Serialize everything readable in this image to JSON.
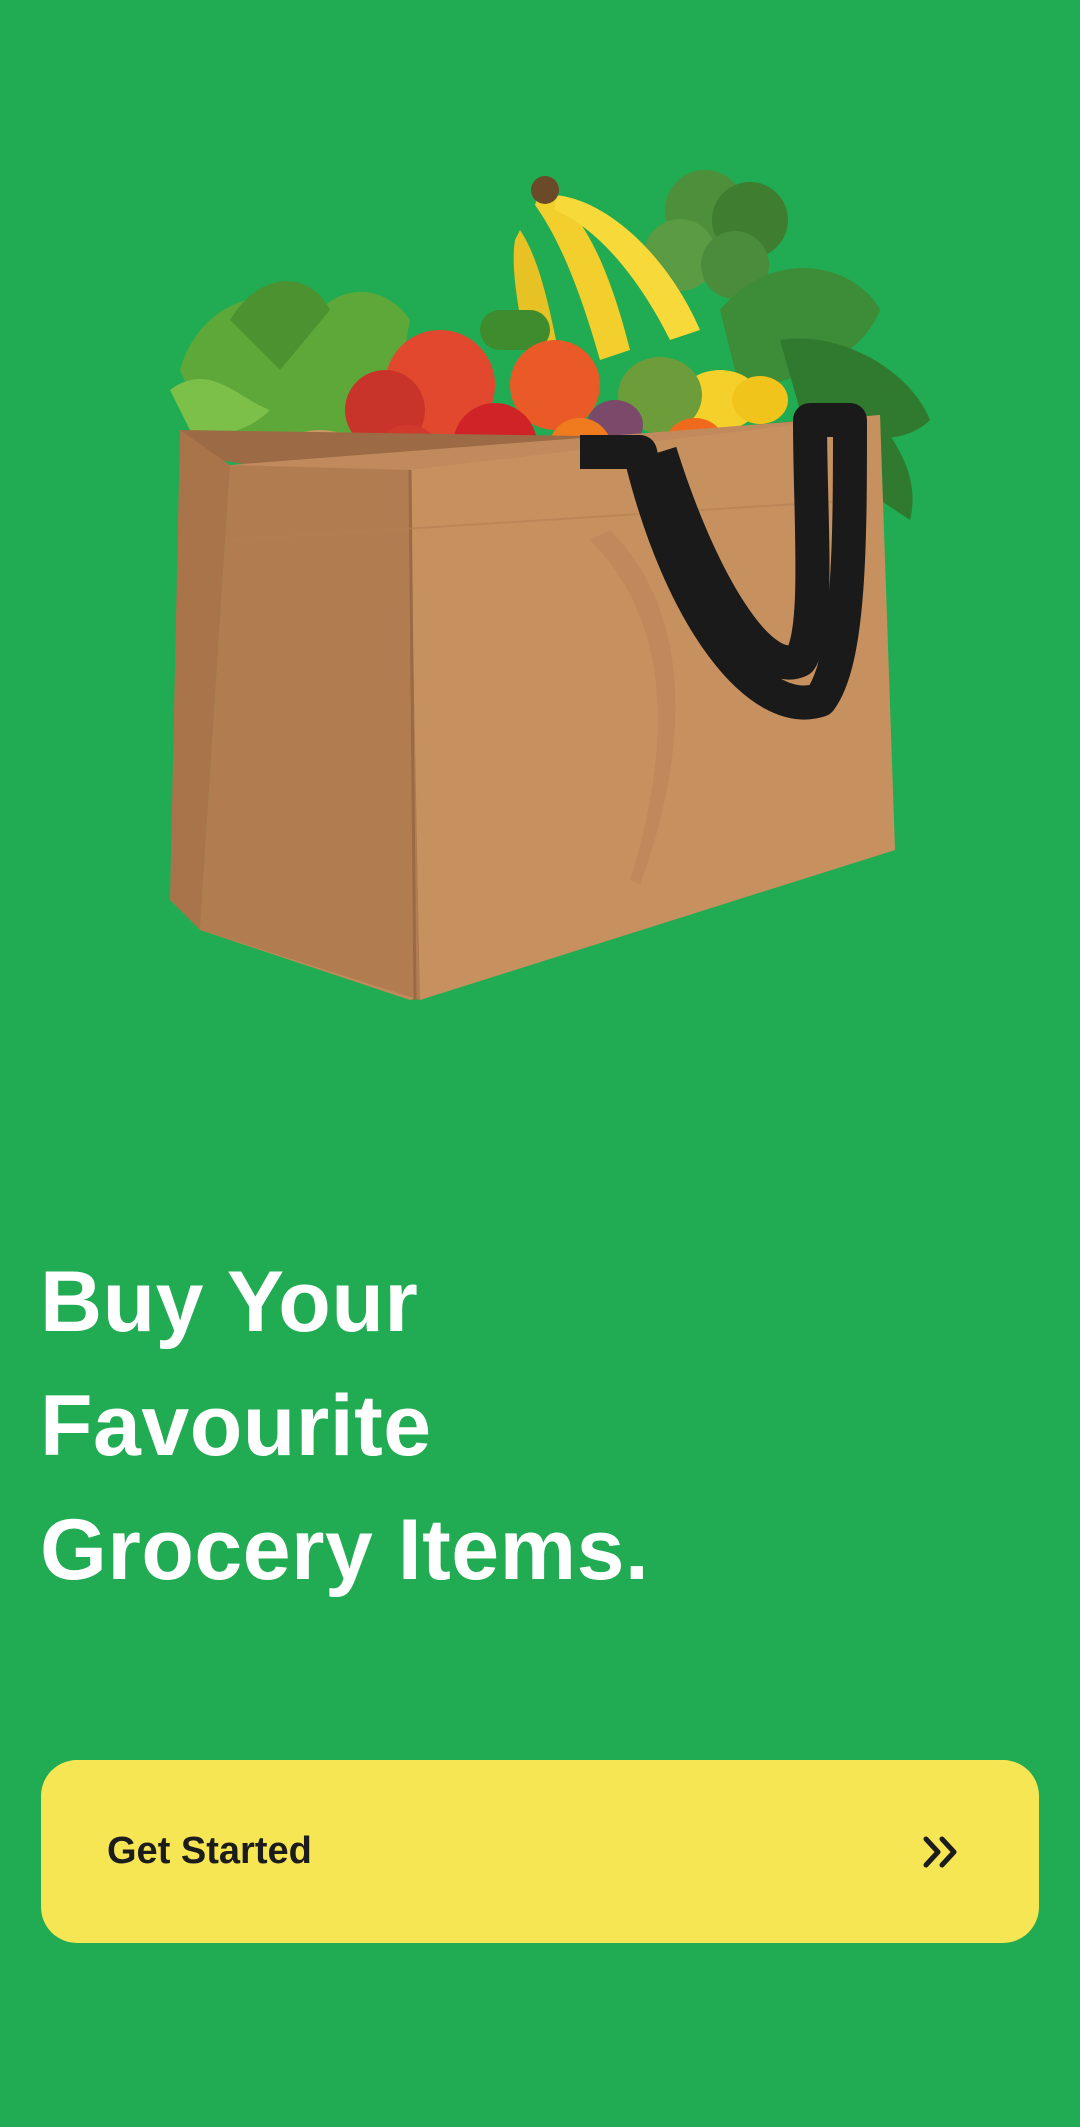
{
  "hero": {
    "image": "grocery-bag-illustration"
  },
  "headline": {
    "line1": "Buy Your",
    "line2": "Favourite",
    "line3": "Grocery Items."
  },
  "cta": {
    "label": "Get Started",
    "icon": "double-chevron-right-icon"
  },
  "colors": {
    "background": "#21ab53",
    "button": "#f7e654",
    "headline": "#ffffff",
    "button_text": "#1c1c1c"
  }
}
